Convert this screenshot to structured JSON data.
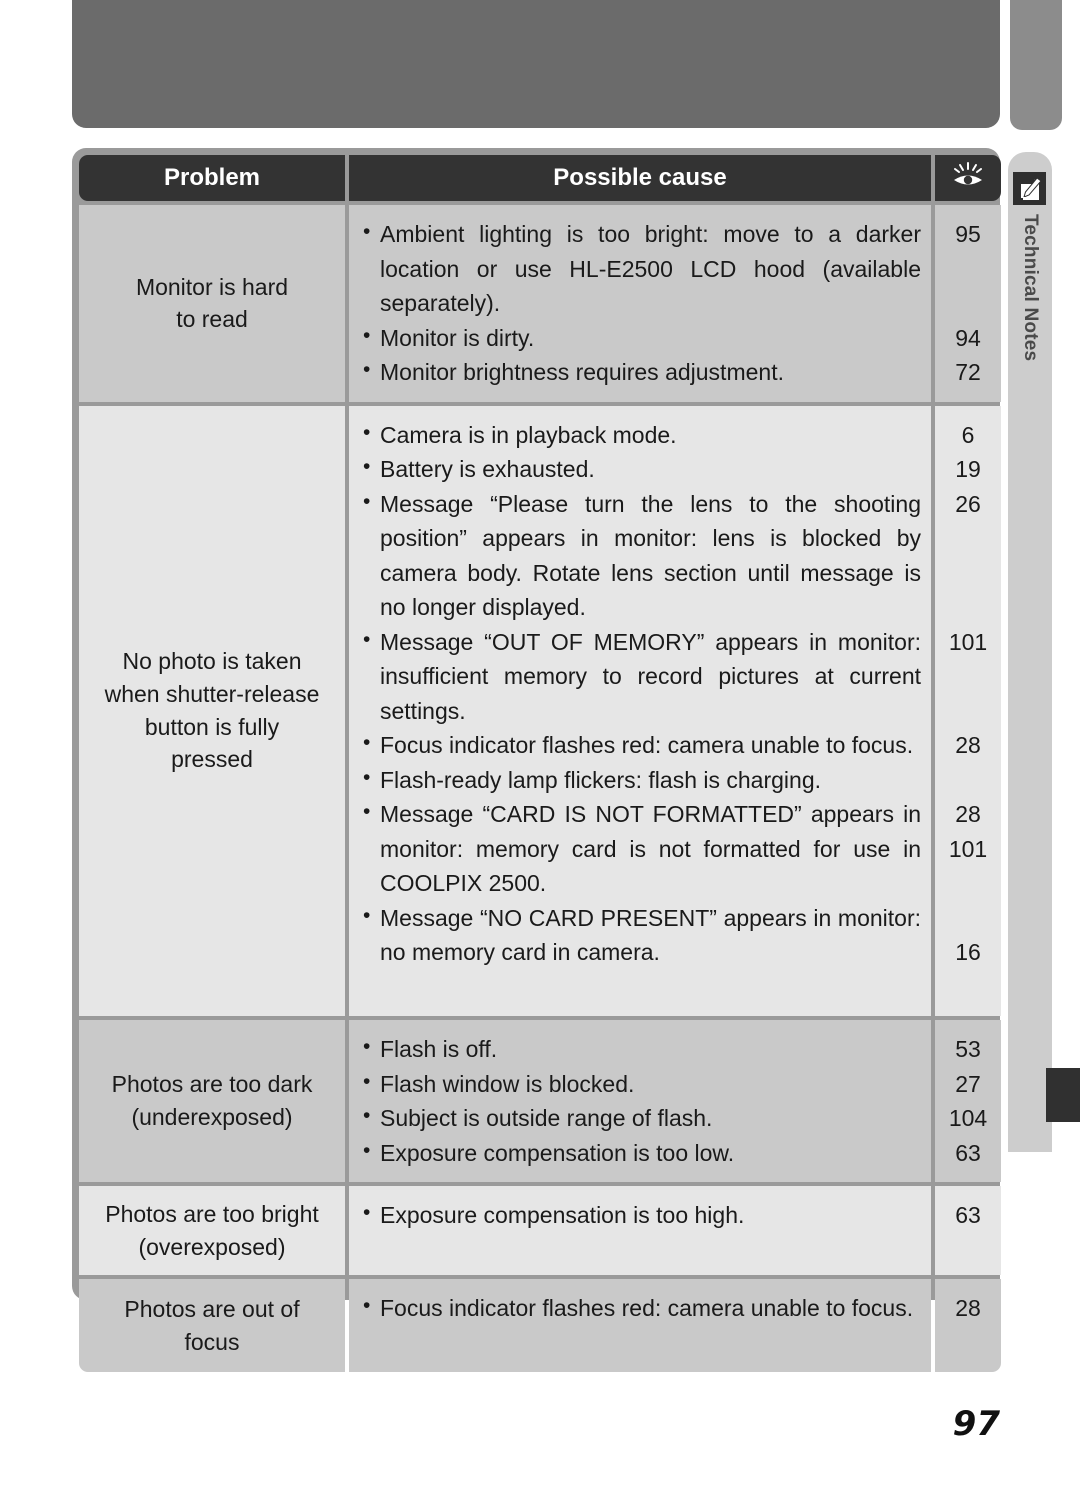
{
  "document": {
    "folio": "97",
    "side_tab": {
      "label": "Technical Notes",
      "icon": "pencil-note-icon"
    }
  },
  "table": {
    "headers": {
      "problem": "Problem",
      "cause": "Possible cause",
      "page_icon": "eye-reference-icon"
    },
    "rows": [
      {
        "problem": "Monitor is hard\nto read",
        "shade": "dark",
        "causes": [
          {
            "text": "Ambient lighting is too bright: move to a darker location or use HL-E2500 LCD hood (available separately).",
            "page": "95",
            "lines": 3
          },
          {
            "text": "Monitor is dirty.",
            "page": "94",
            "lines": 1
          },
          {
            "text": "Monitor brightness requires adjustment.",
            "page": "72",
            "lines": 1
          }
        ]
      },
      {
        "problem": "No photo is taken\nwhen shutter-release\nbutton is fully\npressed",
        "shade": "light",
        "causes": [
          {
            "text": "Camera is in playback mode.",
            "page": "6",
            "lines": 1
          },
          {
            "text": "Battery is exhausted.",
            "page": "19",
            "lines": 1
          },
          {
            "text": "Message “Please turn the lens to the shooting position” appears in monitor: lens is blocked by camera body.  Rotate lens section until message is no longer displayed.",
            "page": "26",
            "lines": 4
          },
          {
            "text": "Message “OUT OF MEMORY” appears in monitor: insufficient memory to record pictures at current settings.",
            "page": "101",
            "lines": 3
          },
          {
            "text": "Focus indicator flashes red: camera unable to focus.",
            "page": "28",
            "lines": 2
          },
          {
            "text": "Flash-ready lamp flickers: flash is charging.",
            "page": "28",
            "lines": 1
          },
          {
            "text": "Message “CARD IS NOT FORMATTED” appears in monitor: memory card is not formatted for use in COOLPIX 2500.",
            "page": "101",
            "lines": 3
          },
          {
            "text": "Message “NO CARD PRESENT” appears in monitor: no memory card in camera.",
            "page": "16",
            "lines": 2
          }
        ]
      },
      {
        "problem": "Photos are too dark\n(underexposed)",
        "shade": "dark",
        "causes": [
          {
            "text": "Flash is off.",
            "page": "53",
            "lines": 1
          },
          {
            "text": "Flash window is blocked.",
            "page": "27",
            "lines": 1
          },
          {
            "text": "Subject is outside range of flash.",
            "page": "104",
            "lines": 1
          },
          {
            "text": "Exposure compensation is too low.",
            "page": "63",
            "lines": 1
          }
        ]
      },
      {
        "problem": "Photos are too bright\n(overexposed)",
        "shade": "light",
        "causes": [
          {
            "text": "Exposure compensation is too high.",
            "page": "63",
            "lines": 1
          }
        ]
      },
      {
        "problem": "Photos are out of\nfocus",
        "shade": "dark",
        "causes": [
          {
            "text": "Focus indicator flashes red: camera unable to focus.",
            "page": "28",
            "lines": 2
          }
        ]
      }
    ]
  }
}
